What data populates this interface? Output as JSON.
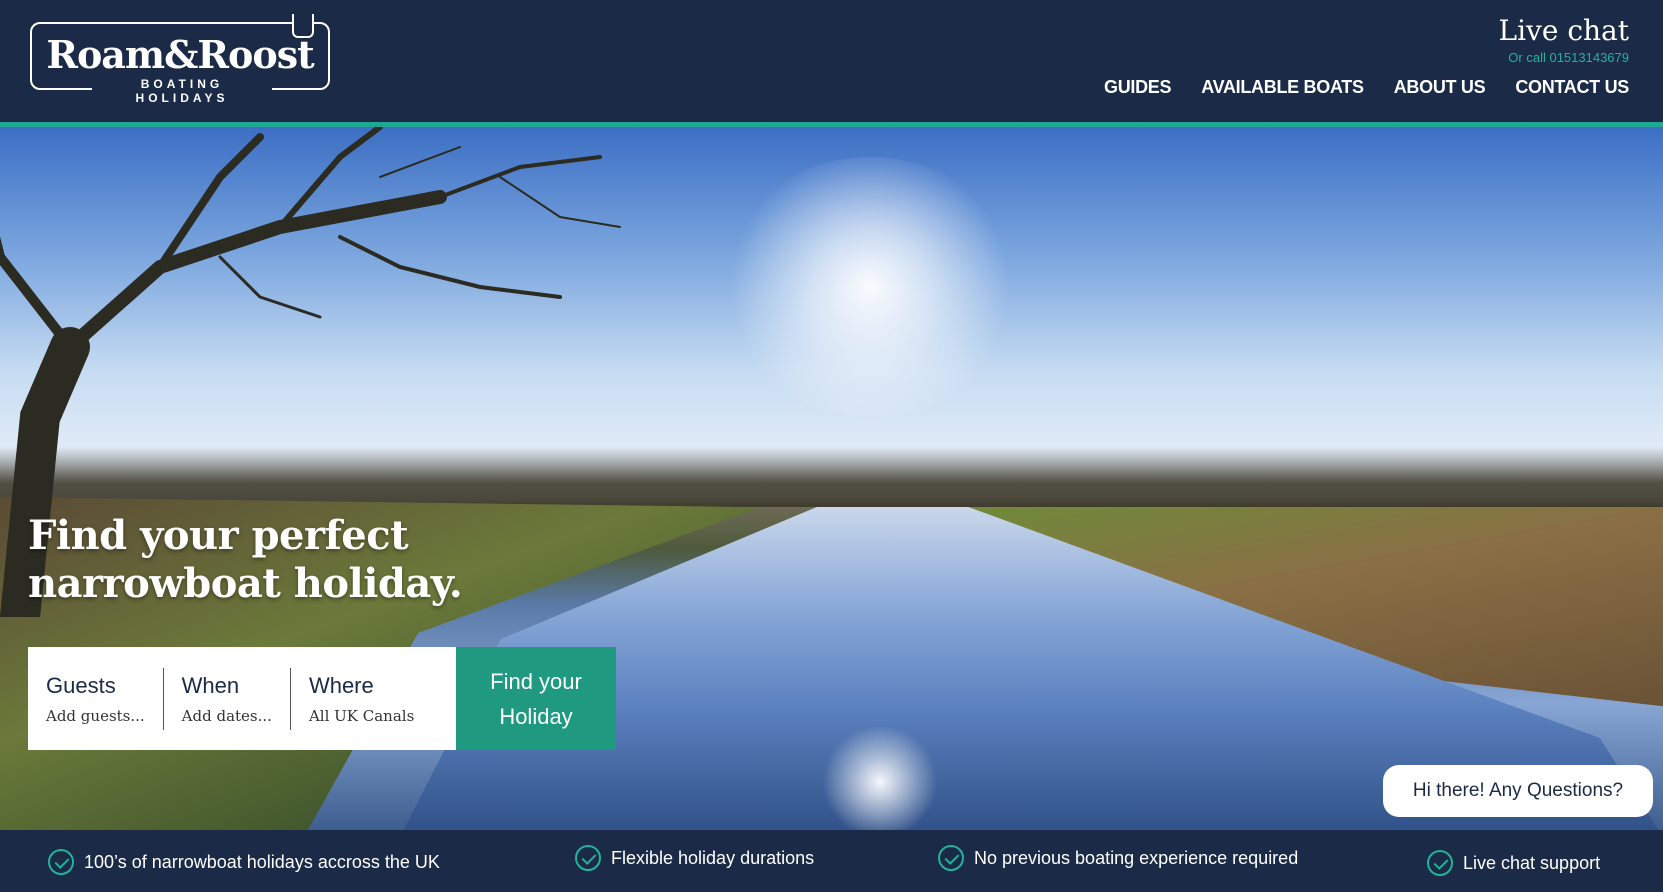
{
  "brand": {
    "name": "Roam&Roost",
    "tagline": "BOATING HOLIDAYS"
  },
  "header": {
    "live_chat": "Live chat",
    "phone": "Or call 01513143679",
    "nav": [
      "GUIDES",
      "AVAILABLE BOATS",
      "ABOUT US",
      "CONTACT US"
    ]
  },
  "hero": {
    "headline": "Find your perfect narrowboat holiday.",
    "search": {
      "guests_title": "Guests",
      "guests_hint": "Add guests...",
      "when_title": "When",
      "when_hint": "Add dates...",
      "where_title": "Where",
      "where_hint": "All UK Canals",
      "button_line1": "Find your",
      "button_line2": "Holiday"
    },
    "chat_prompt": "Hi there! Any Questions?"
  },
  "features": [
    "100’s of narrowboat holidays accross the UK",
    "Flexible holiday durations",
    "No previous boating experience required",
    "Live chat support"
  ],
  "colors": {
    "navy": "#1a2a47",
    "teal": "#1f9a80",
    "teal_light": "#22b39a"
  }
}
